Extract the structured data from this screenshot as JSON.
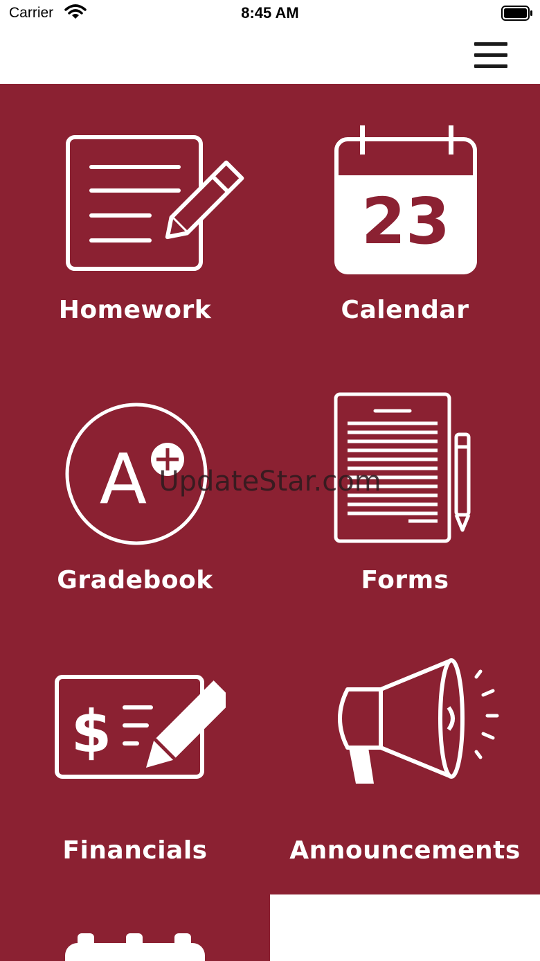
{
  "status_bar": {
    "carrier": "Carrier",
    "time": "8:45 AM"
  },
  "nav": {
    "menu_icon": "hamburger-menu-icon"
  },
  "tiles": [
    {
      "label": "Homework",
      "icon": "homework-icon"
    },
    {
      "label": "Calendar",
      "icon": "calendar-icon",
      "calendar_day": "23"
    },
    {
      "label": "Gradebook",
      "icon": "gradebook-icon",
      "grade": "A"
    },
    {
      "label": "Forms",
      "icon": "forms-icon"
    },
    {
      "label": "Financials",
      "icon": "financials-icon",
      "symbol": "$"
    },
    {
      "label": "Announcements",
      "icon": "megaphone-icon"
    },
    {
      "label": "",
      "icon": "calendar-icon"
    }
  ],
  "watermark": "UpdateStar.com",
  "colors": {
    "tile_background": "#8b2132",
    "icon": "#ffffff"
  }
}
